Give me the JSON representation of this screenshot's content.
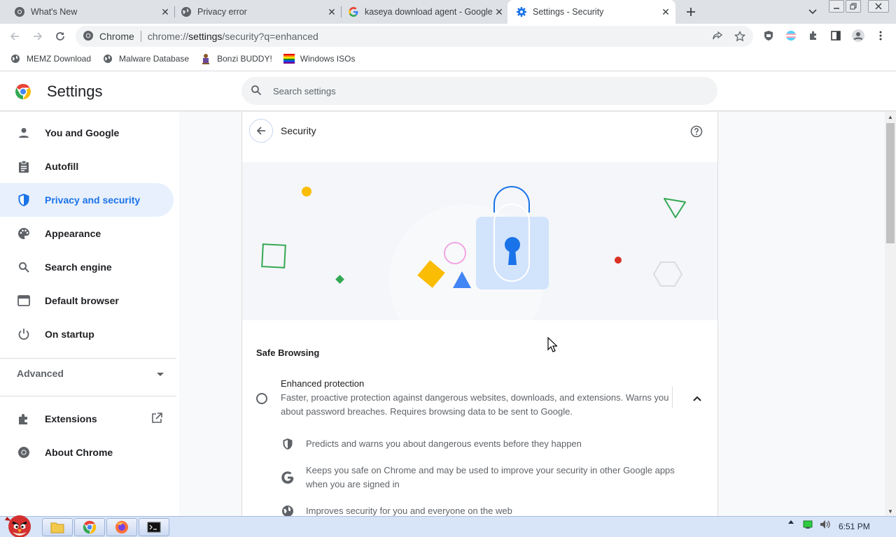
{
  "browser": {
    "tabs": [
      {
        "title": "What's New",
        "icon": "chrome-icon",
        "close": "✕"
      },
      {
        "title": "Privacy error",
        "icon": "globe-icon",
        "close": "✕"
      },
      {
        "title": "kaseya download agent - Google",
        "icon": "google-icon",
        "close": "✕"
      },
      {
        "title": "Settings - Security",
        "icon": "settings-gear-icon",
        "close": "✕"
      }
    ],
    "omnibox": {
      "site": "Chrome",
      "url_host": "chrome://",
      "url_path": "settings",
      "url_rest": "/security?q=enhanced"
    },
    "bookmarks": [
      {
        "label": "MEMZ Download",
        "icon": "globe-icon"
      },
      {
        "label": "Malware Database",
        "icon": "globe-icon"
      },
      {
        "label": "Bonzi BUDDY!",
        "icon": "bonzi-icon"
      },
      {
        "label": "Windows ISOs",
        "icon": "windows-flag-icon"
      }
    ]
  },
  "settings": {
    "title": "Settings",
    "search_placeholder": "Search settings",
    "nav": [
      {
        "label": "You and Google",
        "icon": "person-icon"
      },
      {
        "label": "Autofill",
        "icon": "clipboard-icon"
      },
      {
        "label": "Privacy and security",
        "icon": "shield-icon",
        "selected": true
      },
      {
        "label": "Appearance",
        "icon": "palette-icon"
      },
      {
        "label": "Search engine",
        "icon": "search-icon"
      },
      {
        "label": "Default browser",
        "icon": "browser-window-icon"
      },
      {
        "label": "On startup",
        "icon": "power-icon"
      }
    ],
    "advanced": "Advanced",
    "extra_nav": [
      {
        "label": "Extensions",
        "icon": "puzzle-icon"
      },
      {
        "label": "About Chrome",
        "icon": "chrome-icon"
      }
    ]
  },
  "security_page": {
    "title": "Security",
    "section": "Safe Browsing",
    "option": {
      "title": "Enhanced protection",
      "description": "Faster, proactive protection against dangerous websites, downloads, and extensions. Warns you about password breaches. Requires browsing data to be sent to Google.",
      "selected": false,
      "expanded": true
    },
    "features": [
      {
        "text": "Predicts and warns you about dangerous events before they happen",
        "icon": "shield-icon"
      },
      {
        "text": "Keeps you safe on Chrome and may be used to improve your security in other Google apps when you are signed in",
        "icon": "google-g-icon"
      },
      {
        "text": "Improves security for you and everyone on the web",
        "icon": "globe-icon"
      }
    ]
  },
  "taskbar": {
    "clock": "6:51 PM"
  },
  "colors": {
    "accent": "#1a73e8",
    "selected_bg": "#e8f0fe",
    "taskbar": "#d8e4f8"
  }
}
